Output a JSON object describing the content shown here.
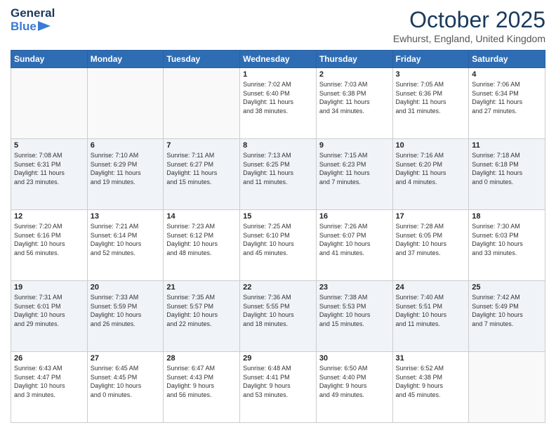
{
  "header": {
    "logo": {
      "line1": "General",
      "line2": "Blue"
    },
    "title": "October 2025",
    "location": "Ewhurst, England, United Kingdom"
  },
  "days_of_week": [
    "Sunday",
    "Monday",
    "Tuesday",
    "Wednesday",
    "Thursday",
    "Friday",
    "Saturday"
  ],
  "weeks": [
    [
      {
        "day": "",
        "info": ""
      },
      {
        "day": "",
        "info": ""
      },
      {
        "day": "",
        "info": ""
      },
      {
        "day": "1",
        "info": "Sunrise: 7:02 AM\nSunset: 6:40 PM\nDaylight: 11 hours\nand 38 minutes."
      },
      {
        "day": "2",
        "info": "Sunrise: 7:03 AM\nSunset: 6:38 PM\nDaylight: 11 hours\nand 34 minutes."
      },
      {
        "day": "3",
        "info": "Sunrise: 7:05 AM\nSunset: 6:36 PM\nDaylight: 11 hours\nand 31 minutes."
      },
      {
        "day": "4",
        "info": "Sunrise: 7:06 AM\nSunset: 6:34 PM\nDaylight: 11 hours\nand 27 minutes."
      }
    ],
    [
      {
        "day": "5",
        "info": "Sunrise: 7:08 AM\nSunset: 6:31 PM\nDaylight: 11 hours\nand 23 minutes."
      },
      {
        "day": "6",
        "info": "Sunrise: 7:10 AM\nSunset: 6:29 PM\nDaylight: 11 hours\nand 19 minutes."
      },
      {
        "day": "7",
        "info": "Sunrise: 7:11 AM\nSunset: 6:27 PM\nDaylight: 11 hours\nand 15 minutes."
      },
      {
        "day": "8",
        "info": "Sunrise: 7:13 AM\nSunset: 6:25 PM\nDaylight: 11 hours\nand 11 minutes."
      },
      {
        "day": "9",
        "info": "Sunrise: 7:15 AM\nSunset: 6:23 PM\nDaylight: 11 hours\nand 7 minutes."
      },
      {
        "day": "10",
        "info": "Sunrise: 7:16 AM\nSunset: 6:20 PM\nDaylight: 11 hours\nand 4 minutes."
      },
      {
        "day": "11",
        "info": "Sunrise: 7:18 AM\nSunset: 6:18 PM\nDaylight: 11 hours\nand 0 minutes."
      }
    ],
    [
      {
        "day": "12",
        "info": "Sunrise: 7:20 AM\nSunset: 6:16 PM\nDaylight: 10 hours\nand 56 minutes."
      },
      {
        "day": "13",
        "info": "Sunrise: 7:21 AM\nSunset: 6:14 PM\nDaylight: 10 hours\nand 52 minutes."
      },
      {
        "day": "14",
        "info": "Sunrise: 7:23 AM\nSunset: 6:12 PM\nDaylight: 10 hours\nand 48 minutes."
      },
      {
        "day": "15",
        "info": "Sunrise: 7:25 AM\nSunset: 6:10 PM\nDaylight: 10 hours\nand 45 minutes."
      },
      {
        "day": "16",
        "info": "Sunrise: 7:26 AM\nSunset: 6:07 PM\nDaylight: 10 hours\nand 41 minutes."
      },
      {
        "day": "17",
        "info": "Sunrise: 7:28 AM\nSunset: 6:05 PM\nDaylight: 10 hours\nand 37 minutes."
      },
      {
        "day": "18",
        "info": "Sunrise: 7:30 AM\nSunset: 6:03 PM\nDaylight: 10 hours\nand 33 minutes."
      }
    ],
    [
      {
        "day": "19",
        "info": "Sunrise: 7:31 AM\nSunset: 6:01 PM\nDaylight: 10 hours\nand 29 minutes."
      },
      {
        "day": "20",
        "info": "Sunrise: 7:33 AM\nSunset: 5:59 PM\nDaylight: 10 hours\nand 26 minutes."
      },
      {
        "day": "21",
        "info": "Sunrise: 7:35 AM\nSunset: 5:57 PM\nDaylight: 10 hours\nand 22 minutes."
      },
      {
        "day": "22",
        "info": "Sunrise: 7:36 AM\nSunset: 5:55 PM\nDaylight: 10 hours\nand 18 minutes."
      },
      {
        "day": "23",
        "info": "Sunrise: 7:38 AM\nSunset: 5:53 PM\nDaylight: 10 hours\nand 15 minutes."
      },
      {
        "day": "24",
        "info": "Sunrise: 7:40 AM\nSunset: 5:51 PM\nDaylight: 10 hours\nand 11 minutes."
      },
      {
        "day": "25",
        "info": "Sunrise: 7:42 AM\nSunset: 5:49 PM\nDaylight: 10 hours\nand 7 minutes."
      }
    ],
    [
      {
        "day": "26",
        "info": "Sunrise: 6:43 AM\nSunset: 4:47 PM\nDaylight: 10 hours\nand 3 minutes."
      },
      {
        "day": "27",
        "info": "Sunrise: 6:45 AM\nSunset: 4:45 PM\nDaylight: 10 hours\nand 0 minutes."
      },
      {
        "day": "28",
        "info": "Sunrise: 6:47 AM\nSunset: 4:43 PM\nDaylight: 9 hours\nand 56 minutes."
      },
      {
        "day": "29",
        "info": "Sunrise: 6:48 AM\nSunset: 4:41 PM\nDaylight: 9 hours\nand 53 minutes."
      },
      {
        "day": "30",
        "info": "Sunrise: 6:50 AM\nSunset: 4:40 PM\nDaylight: 9 hours\nand 49 minutes."
      },
      {
        "day": "31",
        "info": "Sunrise: 6:52 AM\nSunset: 4:38 PM\nDaylight: 9 hours\nand 45 minutes."
      },
      {
        "day": "",
        "info": ""
      }
    ]
  ]
}
